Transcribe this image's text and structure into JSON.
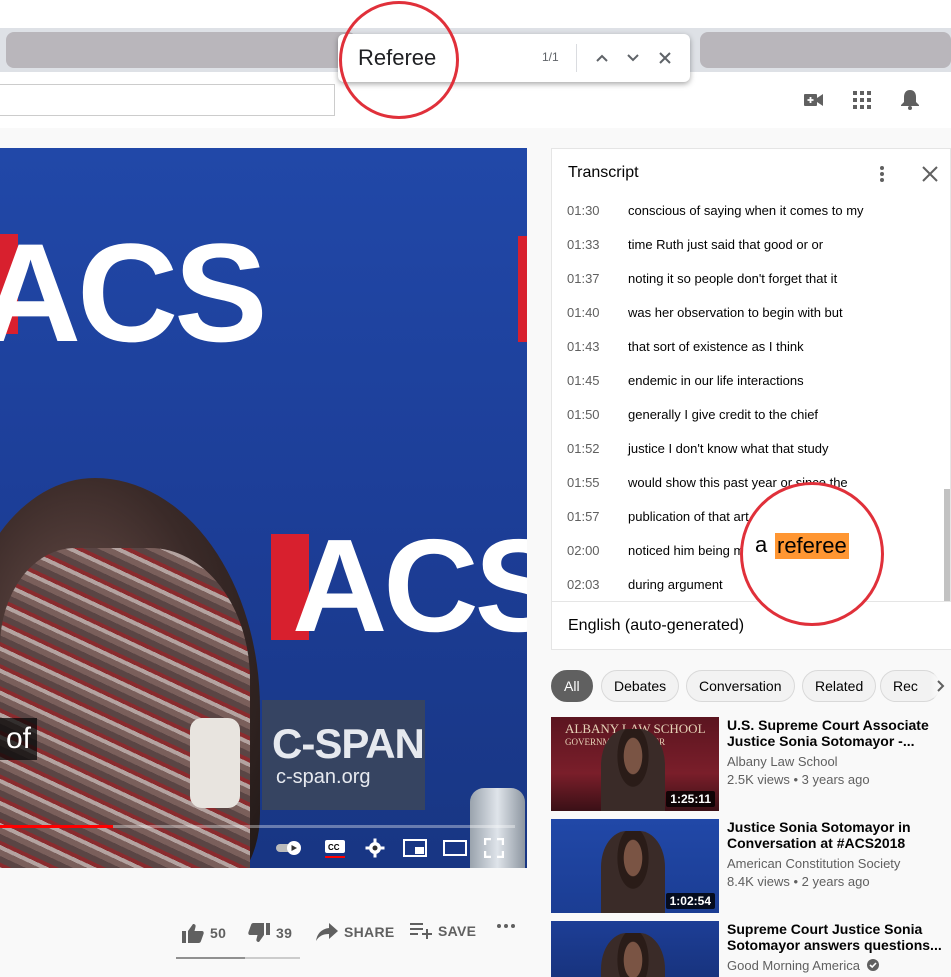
{
  "find_bar": {
    "query": "Referee",
    "match_count": "1/1"
  },
  "player": {
    "caption_text": "of",
    "watermark_name": "C-SPAN",
    "watermark_url": "c-span.org",
    "stage_logo": "ACS",
    "progress_fraction": 0.22
  },
  "actions": {
    "likes": "50",
    "dislikes": "39",
    "share_label": "SHARE",
    "save_label": "SAVE",
    "like_fraction": 0.56
  },
  "transcript": {
    "title": "Transcript",
    "language": "English (auto-generated)",
    "segments": [
      {
        "time": "01:30",
        "text": "conscious of saying when it comes to my"
      },
      {
        "time": "01:33",
        "text": "time Ruth just said that good or or"
      },
      {
        "time": "01:37",
        "text": "noting it so people don't forget that it"
      },
      {
        "time": "01:40",
        "text": "was her observation to begin with but"
      },
      {
        "time": "01:43",
        "text": "that sort of existence as I think"
      },
      {
        "time": "01:45",
        "text": "endemic in our life interactions"
      },
      {
        "time": "01:50",
        "text": "generally I give credit to the chief"
      },
      {
        "time": "01:52",
        "text": "justice I don't know what that study"
      },
      {
        "time": "01:55",
        "text": "would show this past year or since the"
      },
      {
        "time": "01:57",
        "text": "publication of that art"
      },
      {
        "time": "02:00",
        "text": "noticed him being m"
      },
      {
        "time": "02:03",
        "text": "during argument"
      }
    ],
    "highlight_prefix": "a",
    "highlight_match": "referee"
  },
  "chips": [
    "All",
    "Debates",
    "Conversation",
    "Related",
    "Rec"
  ],
  "related": [
    {
      "title": "U.S. Supreme Court Associate Justice Sonia Sotomayor -...",
      "channel": "Albany Law School",
      "meta": "2.5K views • 3 years ago",
      "duration": "1:25:11",
      "thumb_line1": "ALBANY LAW SCHOOL",
      "thumb_line2": "GOVERNMENT CENTER"
    },
    {
      "title": "Justice Sonia Sotomayor in Conversation at #ACS2018",
      "channel": "American Constitution Society",
      "meta": "8.4K views • 2 years ago",
      "duration": "1:02:54"
    },
    {
      "title": "Supreme Court Justice Sonia Sotomayor answers questions...",
      "channel": "Good Morning America",
      "meta": "",
      "duration": ""
    }
  ],
  "colors": {
    "highlight": "#ff9632",
    "callout": "#e0303a",
    "progress": "#ff0000"
  }
}
